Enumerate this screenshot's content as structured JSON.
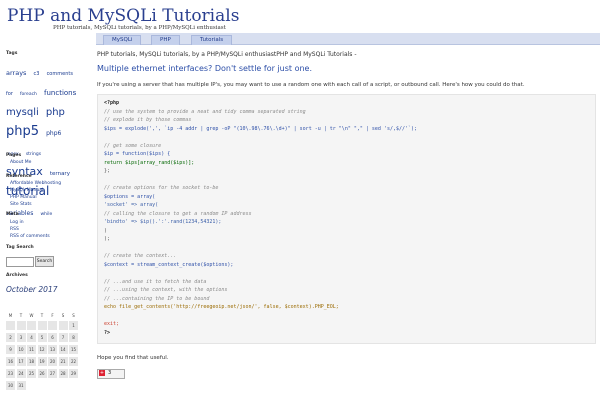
{
  "site": {
    "title": "PHP and MySQLi Tutorials",
    "description": "PHP tutorials, MySQLi tutorials, by a PHP/MySQLi enthusiast"
  },
  "nav": {
    "tabs": [
      "MySQLi",
      "PHP",
      "Tutorials"
    ]
  },
  "sidebar": {
    "tags_title": "Tags",
    "tags": [
      {
        "label": "arrays",
        "size": 6.5
      },
      {
        "label": "c3",
        "size": 5
      },
      {
        "label": "comments",
        "size": 5
      },
      {
        "label": "for",
        "size": 5
      },
      {
        "label": "foreach",
        "size": 4.5
      },
      {
        "label": "functions",
        "size": 7
      },
      {
        "label": "mysqli",
        "size": 10
      },
      {
        "label": "php",
        "size": 10
      },
      {
        "label": "php5",
        "size": 13
      },
      {
        "label": "php6",
        "size": 6
      },
      {
        "label": "regex",
        "size": 4.5
      },
      {
        "label": "strings",
        "size": 4.5
      },
      {
        "label": "syntax",
        "size": 11
      },
      {
        "label": "ternary",
        "size": 5.5
      },
      {
        "label": "tutorial",
        "size": 12
      },
      {
        "label": "variables",
        "size": 6
      },
      {
        "label": "while",
        "size": 4.5
      }
    ],
    "pages_title": "Pages",
    "pages": [
      "About Me"
    ],
    "reference_title": "Reference",
    "reference": [
      "Affordable Webhosting",
      "MySQL Manual",
      "PHP Manual",
      "Site Stats"
    ],
    "meta_title": "Meta",
    "meta": [
      "Log in",
      "RSS",
      "RSS of comments"
    ],
    "search_title": "Tag Search",
    "search_button": "Search",
    "archives_title": "Archives",
    "archive_month": "October 2017",
    "calendar_head": [
      "M",
      "T",
      "W",
      "T",
      "F",
      "S",
      "S"
    ],
    "calendar_days": [
      "",
      "",
      "",
      "",
      "",
      "",
      "1",
      "2",
      "3",
      "4",
      "5",
      "6",
      "7",
      "8",
      "9",
      "10",
      "11",
      "12",
      "13",
      "14",
      "15",
      "16",
      "17",
      "18",
      "19",
      "20",
      "21",
      "22",
      "23",
      "24",
      "25",
      "26",
      "27",
      "28",
      "29",
      "30",
      "31"
    ]
  },
  "post": {
    "intro": "PHP tutorials, MySQLi tutorials, by a PHP/MySQLi enthusiastPHP and MySQLi Tutorials -",
    "title": "Multiple ethernet interfaces? Don't settle for just one.",
    "lead": "If you're using a server that has multiple IP's, you may want to use a random one with each call of a script, or outbound call. Here's how you could do that.",
    "outro": "Hope you find that useful.",
    "share_count": "3"
  },
  "code": {
    "lines": [
      {
        "t": "<?php",
        "c": "c-php"
      },
      {
        "t": "// use the system to provide a neat and tidy comma separated string",
        "c": "c-com"
      },
      {
        "t": "// explode it by those commas",
        "c": "c-com"
      },
      {
        "t": "$ips = explode(',', `ip -4 addr | grep -oP \"(10\\.98\\.76\\.\\d+)\" | sort -u | tr \"\\n\" \",\" | sed 's/,$//'`);",
        "c": "c-var"
      },
      {
        "t": "",
        "c": ""
      },
      {
        "t": "// get some closure",
        "c": "c-com"
      },
      {
        "t": "$ip = function($ips) {",
        "c": "c-var"
      },
      {
        "t": "    return $ips[array_rand($ips)];",
        "c": "c-fn"
      },
      {
        "t": "};",
        "c": "c-txt"
      },
      {
        "t": "",
        "c": ""
      },
      {
        "t": "// create options for the socket to-be",
        "c": "c-com"
      },
      {
        "t": "$options = array(",
        "c": "c-var"
      },
      {
        "t": "    'socket' => array(",
        "c": "c-str"
      },
      {
        "t": "        // calling the closure to get a random IP address",
        "c": "c-com"
      },
      {
        "t": "        'bindto' => $ip().':'.rand(1234,54321);",
        "c": "c-str"
      },
      {
        "t": "    )",
        "c": "c-txt"
      },
      {
        "t": ");",
        "c": "c-txt"
      },
      {
        "t": "",
        "c": ""
      },
      {
        "t": "// create the context...",
        "c": "c-com"
      },
      {
        "t": "$context = stream_context_create($options);",
        "c": "c-var"
      },
      {
        "t": "",
        "c": ""
      },
      {
        "t": "// ...and use it to fetch the data",
        "c": "c-com"
      },
      {
        "t": "// ...using the context, with the options",
        "c": "c-com"
      },
      {
        "t": "// ...containing the IP to be bound",
        "c": "c-com"
      },
      {
        "t": "echo file_get_contents('http://freegeoip.net/json/', false, $context).PHP_EOL;",
        "c": "c-kw"
      },
      {
        "t": "",
        "c": ""
      },
      {
        "t": "exit;",
        "c": "c-exit"
      },
      {
        "t": "?>",
        "c": "c-php"
      }
    ]
  },
  "colors": {
    "title": "#2a3f8f",
    "nav_bg": "#d8dff0",
    "link": "#1a3b8f"
  }
}
